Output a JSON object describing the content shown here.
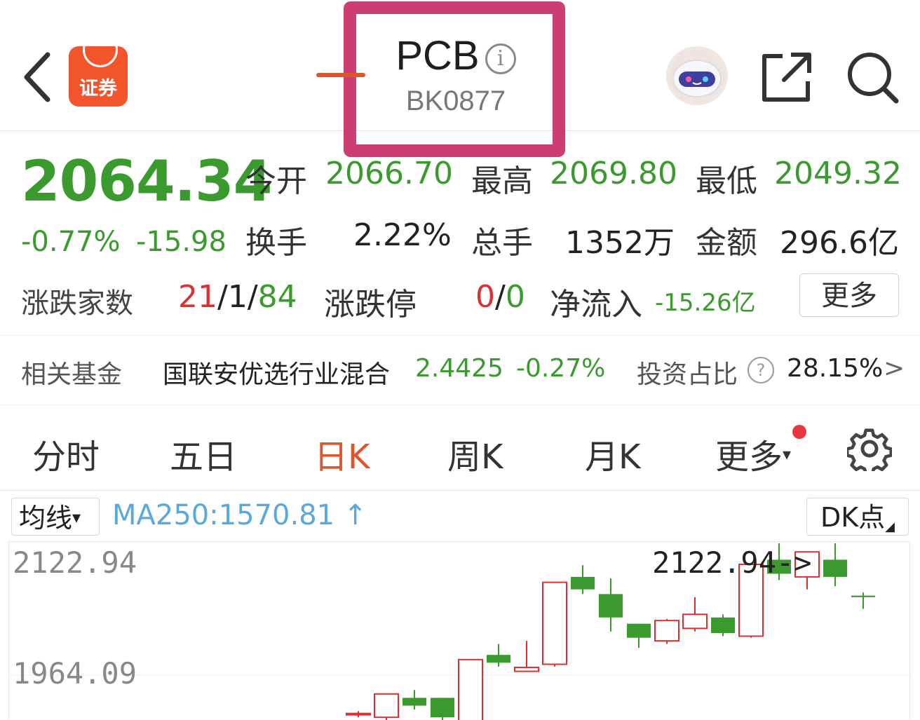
{
  "header": {
    "title": "PCB",
    "info_glyph": "i",
    "code": "BK0877",
    "logo_text": "证券",
    "icons": [
      "back-icon",
      "app-logo",
      "info-icon",
      "robot-avatar-icon",
      "share-icon",
      "search-icon"
    ]
  },
  "quote": {
    "price": "2064.34",
    "change_pct": "-0.77%",
    "change_val": "-15.98",
    "open_label": "今开",
    "open": "2066.70",
    "high_label": "最高",
    "high": "2069.80",
    "low_label": "最低",
    "low": "2049.32",
    "turnover_label": "换手",
    "turnover": "2.22%",
    "volume_label": "总手",
    "volume": "1352万",
    "amount_label": "金额",
    "amount": "296.6亿",
    "breadth_label": "涨跌家数",
    "breadth_up": "21",
    "breadth_sep1": "/",
    "breadth_flat": "1",
    "breadth_sep2": "/",
    "breadth_down": "84",
    "limit_label": "涨跌停",
    "limit_up": "0",
    "limit_sep": "/",
    "limit_down": "0",
    "inflow_label": "净流入",
    "inflow": "-15.26亿",
    "more_label": "更多"
  },
  "fund": {
    "label": "相关基金",
    "name": "国联安优选行业混合",
    "nav": "2.4425",
    "change": "-0.27%",
    "ratio_label": "投资占比",
    "ratio_help": "?",
    "ratio": "28.15%",
    "arrow": ">"
  },
  "tabs": [
    {
      "label": "分时"
    },
    {
      "label": "五日"
    },
    {
      "label": "日K"
    },
    {
      "label": "周K"
    },
    {
      "label": "月K"
    },
    {
      "label": "更多"
    }
  ],
  "active_tab": "日K",
  "more_tab_arrow": "▾",
  "ma": {
    "select_label": "均线",
    "select_arrow": "▾",
    "value": "MA250:1570.81",
    "trend_arrow": "↑",
    "dk_label": "DK点",
    "dk_corner": "◢"
  },
  "colors": {
    "up": "#dd3030",
    "down": "#3a9a2e",
    "accent": "#e0542a",
    "highlight_box": "#cc3d73",
    "ma_blue": "#5aa9dc"
  },
  "chart_data": {
    "type": "candlestick",
    "y_labels": [
      "2122.94",
      "1964.09"
    ],
    "annotation": "2122.94->",
    "candles": [
      {
        "open": 1915,
        "close": 1915,
        "high": 1918,
        "low": 1910
      },
      {
        "open": 1910,
        "close": 1940,
        "high": 1940,
        "low": 1905
      },
      {
        "open": 1935,
        "close": 1925,
        "high": 1945,
        "low": 1920
      },
      {
        "open": 1935,
        "close": 1910,
        "high": 1935,
        "low": 1905
      },
      {
        "open": 1905,
        "close": 1984,
        "high": 1984,
        "low": 1900
      },
      {
        "open": 1990,
        "close": 1980,
        "high": 2004,
        "low": 1975
      },
      {
        "open": 1969,
        "close": 1974,
        "high": 2008,
        "low": 1968
      },
      {
        "open": 1978,
        "close": 2083,
        "high": 2083,
        "low": 1975
      },
      {
        "open": 2090,
        "close": 2074,
        "high": 2105,
        "low": 2068
      },
      {
        "open": 2068,
        "close": 2038,
        "high": 2088,
        "low": 2020
      },
      {
        "open": 2030,
        "close": 2012,
        "high": 2030,
        "low": 1999
      },
      {
        "open": 2008,
        "close": 2034,
        "high": 2036,
        "low": 2004
      },
      {
        "open": 2024,
        "close": 2042,
        "high": 2064,
        "low": 2020
      },
      {
        "open": 2038,
        "close": 2018,
        "high": 2042,
        "low": 2014
      },
      {
        "open": 2014,
        "close": 2106,
        "high": 2106,
        "low": 2012
      },
      {
        "open": 2112,
        "close": 2094,
        "high": 2133,
        "low": 2086
      },
      {
        "open": 2090,
        "close": 2122,
        "high": 2122,
        "low": 2074
      },
      {
        "open": 2112,
        "close": 2090,
        "high": 2133,
        "low": 2078
      },
      {
        "open": 2066,
        "close": 2064,
        "high": 2070,
        "low": 2049
      }
    ]
  }
}
